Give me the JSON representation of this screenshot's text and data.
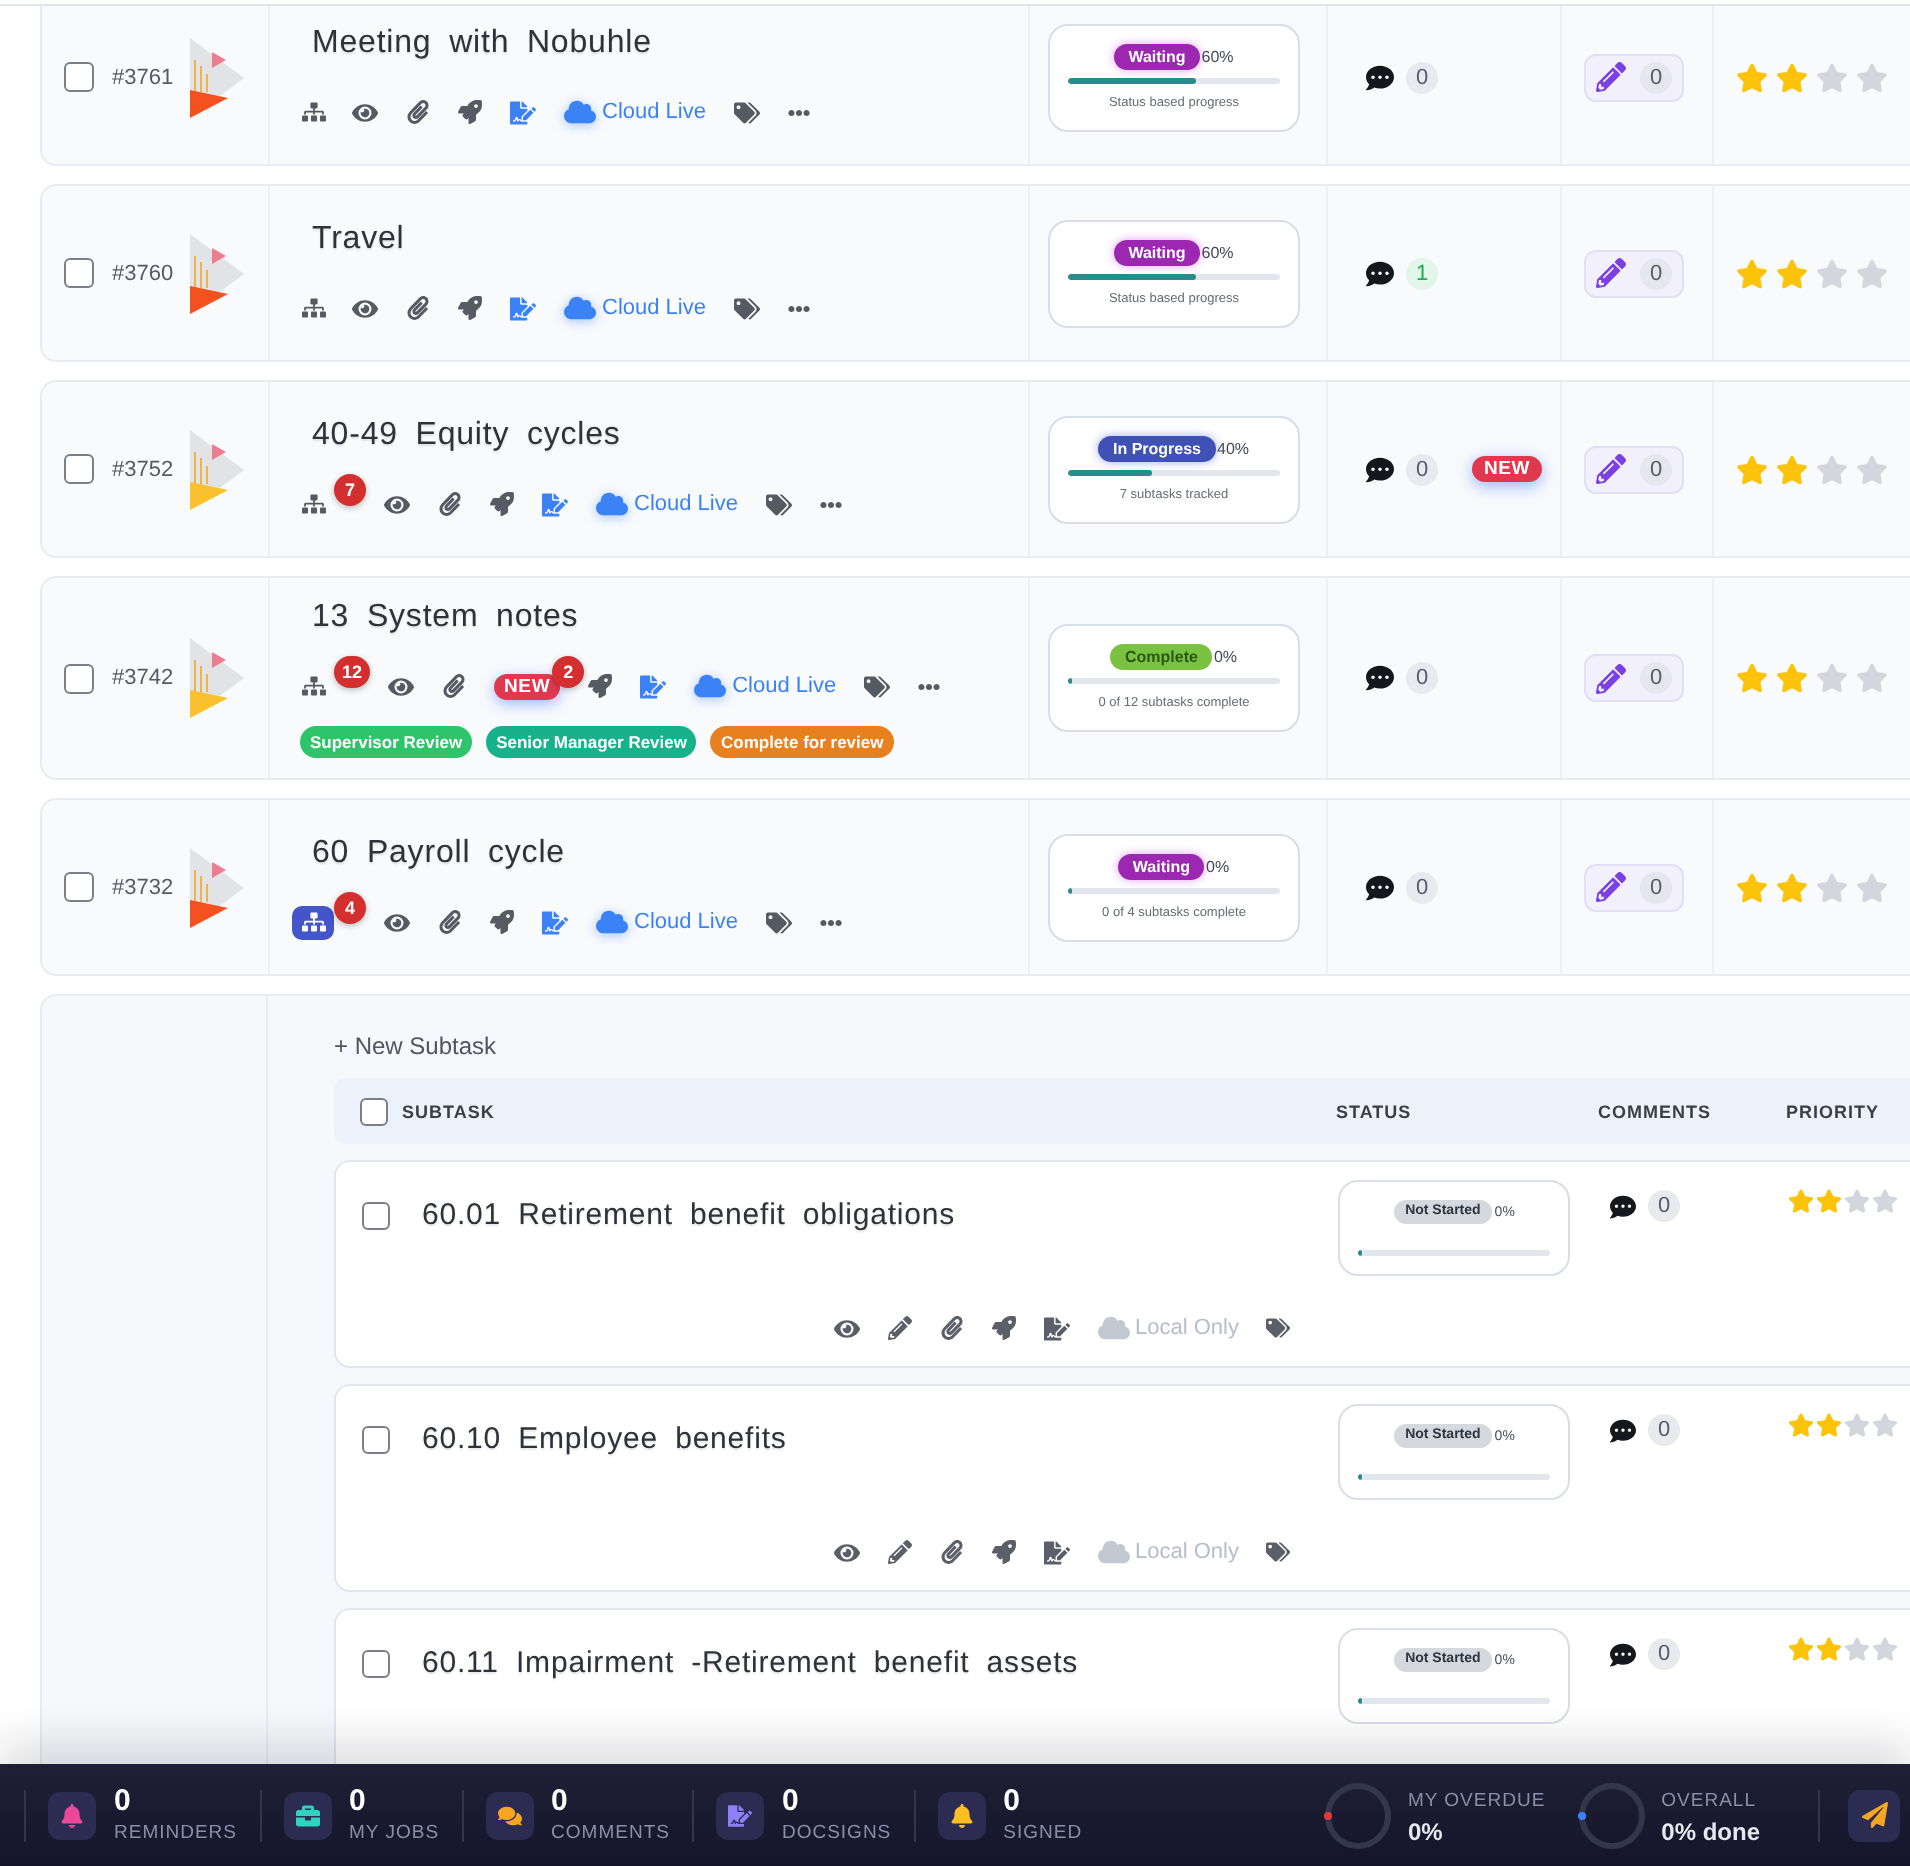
{
  "tasks": [
    {
      "id": "#3761",
      "checked": false,
      "color": "#f4511e",
      "title": "Meeting with Nobuhle",
      "subtasks_expanded": false,
      "sync": {
        "label": "Cloud Live",
        "live": true
      },
      "status": {
        "kind": "waiting",
        "label": "Waiting",
        "percent": "60%",
        "level": 0.6,
        "caption": "Status based progress"
      },
      "comments": {
        "count": "0",
        "unread": false
      },
      "edit_count": "0",
      "stars": 2
    },
    {
      "id": "#3760",
      "checked": false,
      "color": "#f4511e",
      "title": "Travel",
      "subtasks_expanded": false,
      "sync": {
        "label": "Cloud Live",
        "live": true
      },
      "status": {
        "kind": "waiting",
        "label": "Waiting",
        "percent": "60%",
        "level": 0.6,
        "caption": "Status based progress"
      },
      "comments": {
        "count": "1",
        "unread": true
      },
      "edit_count": "0",
      "stars": 2
    },
    {
      "id": "#3752",
      "checked": false,
      "color": "#fbc02d",
      "title": "40-49 Equity cycles",
      "subtasks_expanded": false,
      "subtasks_badge": "7",
      "sync": {
        "label": "Cloud Live",
        "live": true
      },
      "status": {
        "kind": "in_progress",
        "label": "In Progress",
        "percent": "40%",
        "level": 0.4,
        "caption": "7 subtasks tracked"
      },
      "comments": {
        "count": "0",
        "unread": false,
        "badge": "NEW"
      },
      "edit_count": "0",
      "stars": 2
    },
    {
      "id": "#3742",
      "checked": false,
      "color": "#fbc02d",
      "title": "13 System notes",
      "subtasks_expanded": false,
      "subtasks_badge": "12",
      "new_flag": {
        "label": "NEW",
        "count": "2"
      },
      "sync": {
        "label": "Cloud Live",
        "live": true
      },
      "tags": [
        {
          "label": "Supervisor Review",
          "color": "#2ec56a"
        },
        {
          "label": "Senior Manager Review",
          "color": "#17b28c"
        },
        {
          "label": "Complete for review",
          "color": "#e8801f"
        }
      ],
      "status": {
        "kind": "complete",
        "label": "Complete",
        "percent": "0%",
        "level": 0,
        "caption": "0 of 12 subtasks complete"
      },
      "comments": {
        "count": "0",
        "unread": false
      },
      "edit_count": "0",
      "stars": 2
    },
    {
      "id": "#3732",
      "checked": false,
      "color": "#f4511e",
      "title": "60 Payroll cycle",
      "subtasks_expanded": true,
      "subtasks_badge": "4",
      "sync": {
        "label": "Cloud Live",
        "live": true
      },
      "status": {
        "kind": "waiting",
        "label": "Waiting",
        "percent": "0%",
        "level": 0,
        "caption": "0 of 4 subtasks complete"
      },
      "comments": {
        "count": "0",
        "unread": false
      },
      "edit_count": "0",
      "stars": 2
    }
  ],
  "subtask_panel": {
    "new_button": "+ New Subtask",
    "header_checked": false,
    "columns": [
      "SUBTASK",
      "STATUS",
      "COMMENTS",
      "PRIORITY"
    ],
    "rows": [
      {
        "checked": false,
        "title": "60.01 Retirement benefit obligations",
        "status": {
          "kind": "not_started",
          "label": "Not Started",
          "percent": "0%",
          "level": 0
        },
        "comments": {
          "count": "0"
        },
        "stars": 2,
        "sync": {
          "label": "Local Only",
          "live": false
        }
      },
      {
        "checked": false,
        "title": "60.10 Employee benefits",
        "status": {
          "kind": "not_started",
          "label": "Not Started",
          "percent": "0%",
          "level": 0
        },
        "comments": {
          "count": "0"
        },
        "stars": 2,
        "sync": {
          "label": "Local Only",
          "live": false
        }
      },
      {
        "checked": false,
        "title": "60.11 Impairment -Retirement benefit assets",
        "status": {
          "kind": "not_started",
          "label": "Not Started",
          "percent": "0%",
          "level": 0
        },
        "comments": {
          "count": "0"
        },
        "stars": 2
      }
    ]
  },
  "footer": {
    "stats": [
      {
        "kind": "reminders",
        "count": "0",
        "label": "REMINDERS"
      },
      {
        "kind": "jobs",
        "count": "0",
        "label": "MY JOBS"
      },
      {
        "kind": "comments",
        "count": "0",
        "label": "COMMENTS"
      },
      {
        "kind": "docsigns",
        "count": "0",
        "label": "DOCSIGNS"
      },
      {
        "kind": "signed",
        "count": "0",
        "label": "SIGNED"
      }
    ],
    "meters": [
      {
        "label": "MY OVERDUE",
        "value": "0%",
        "level": 0,
        "color": "#e53935"
      },
      {
        "label": "OVERALL",
        "value": "0% done",
        "level": 0,
        "color": "#3b82f6"
      }
    ]
  }
}
